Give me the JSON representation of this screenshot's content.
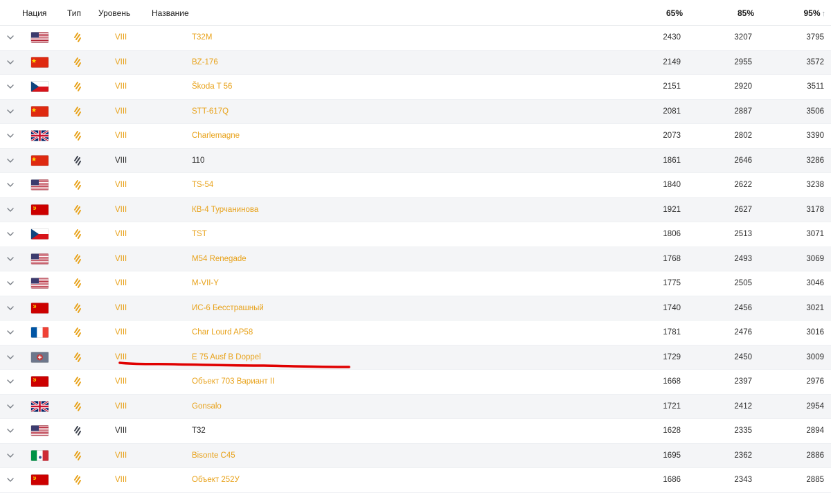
{
  "header": {
    "nation": "Нация",
    "type": "Тип",
    "tier": "Уровень",
    "name": "Название",
    "p65": "65%",
    "p85": "85%",
    "p95": "95%",
    "sort_arrow_icon": "arrow-up-icon"
  },
  "colors": {
    "premium": "#e8a21a",
    "regular": "#2b2b2b",
    "stripe": "#f4f5f7",
    "highlight": "#e00000"
  },
  "rows": [
    {
      "flag": "usa",
      "type": "premium",
      "tier": "VIII",
      "name": "T32M",
      "p65": "2430",
      "p85": "3207",
      "p95": "3795"
    },
    {
      "flag": "china",
      "type": "premium",
      "tier": "VIII",
      "name": "BZ-176",
      "p65": "2149",
      "p85": "2955",
      "p95": "3572"
    },
    {
      "flag": "czech",
      "type": "premium",
      "tier": "VIII",
      "name": "Škoda T 56",
      "p65": "2151",
      "p85": "2920",
      "p95": "3511"
    },
    {
      "flag": "china",
      "type": "premium",
      "tier": "VIII",
      "name": "STT-617Q",
      "p65": "2081",
      "p85": "2887",
      "p95": "3506"
    },
    {
      "flag": "uk",
      "type": "premium",
      "tier": "VIII",
      "name": "Charlemagne",
      "p65": "2073",
      "p85": "2802",
      "p95": "3390"
    },
    {
      "flag": "china",
      "type": "regular",
      "tier": "VIII",
      "name": "110",
      "p65": "1861",
      "p85": "2646",
      "p95": "3286"
    },
    {
      "flag": "usa",
      "type": "premium",
      "tier": "VIII",
      "name": "TS-54",
      "p65": "1840",
      "p85": "2622",
      "p95": "3238"
    },
    {
      "flag": "ussr",
      "type": "premium",
      "tier": "VIII",
      "name": "КВ-4 Турчанинова",
      "p65": "1921",
      "p85": "2627",
      "p95": "3178"
    },
    {
      "flag": "czech",
      "type": "premium",
      "tier": "VIII",
      "name": "TST",
      "p65": "1806",
      "p85": "2513",
      "p95": "3071"
    },
    {
      "flag": "usa",
      "type": "premium",
      "tier": "VIII",
      "name": "M54 Renegade",
      "p65": "1768",
      "p85": "2493",
      "p95": "3069"
    },
    {
      "flag": "usa",
      "type": "premium",
      "tier": "VIII",
      "name": "M-VII-Y",
      "p65": "1775",
      "p85": "2505",
      "p95": "3046"
    },
    {
      "flag": "ussr",
      "type": "premium",
      "tier": "VIII",
      "name": "ИС-6 Бесстрашный",
      "p65": "1740",
      "p85": "2456",
      "p95": "3021"
    },
    {
      "flag": "france",
      "type": "premium",
      "tier": "VIII",
      "name": "Char Lourd AP58",
      "p65": "1781",
      "p85": "2476",
      "p95": "3016"
    },
    {
      "flag": "germany",
      "type": "premium",
      "tier": "VIII",
      "name": "E 75 Ausf B Doppel",
      "p65": "1729",
      "p85": "2450",
      "p95": "3009",
      "highlighted": true
    },
    {
      "flag": "ussr",
      "type": "premium",
      "tier": "VIII",
      "name": "Объект 703 Вариант II",
      "p65": "1668",
      "p85": "2397",
      "p95": "2976"
    },
    {
      "flag": "uk",
      "type": "premium",
      "tier": "VIII",
      "name": "Gonsalo",
      "p65": "1721",
      "p85": "2412",
      "p95": "2954"
    },
    {
      "flag": "usa",
      "type": "regular",
      "tier": "VIII",
      "name": "T32",
      "p65": "1628",
      "p85": "2335",
      "p95": "2894"
    },
    {
      "flag": "italy",
      "type": "premium",
      "tier": "VIII",
      "name": "Bisonte C45",
      "p65": "1695",
      "p85": "2362",
      "p95": "2886"
    },
    {
      "flag": "ussr",
      "type": "premium",
      "tier": "VIII",
      "name": "Объект 252У",
      "p65": "1686",
      "p85": "2343",
      "p95": "2885"
    }
  ]
}
